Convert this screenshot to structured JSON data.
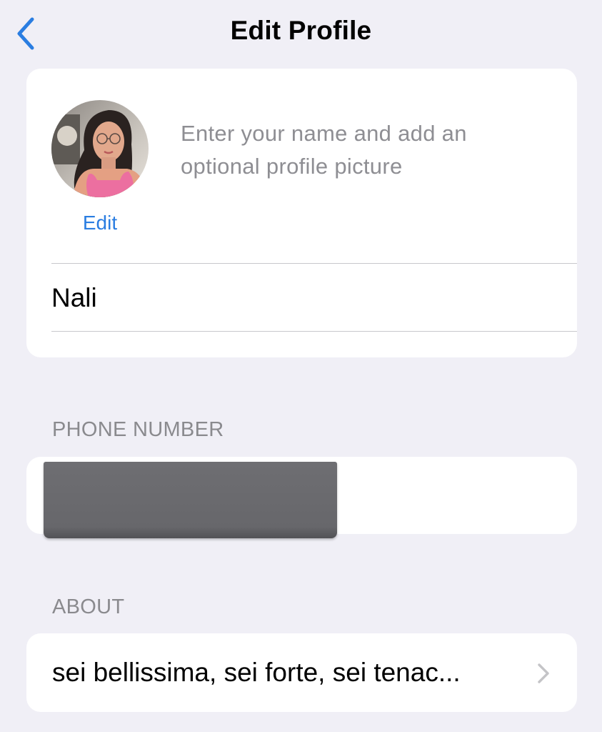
{
  "nav": {
    "title": "Edit Profile",
    "back_icon": "chevron-left-icon",
    "accent_color": "#2a7de1"
  },
  "profile": {
    "hint": "Enter your name and add an optional profile picture",
    "avatar_edit_label": "Edit",
    "name_value": "Nali",
    "name_placeholder": ""
  },
  "phone": {
    "header": "PHONE NUMBER"
  },
  "about": {
    "header": "ABOUT",
    "text": "sei bellissima, sei forte, sei tenac...",
    "chevron_icon": "chevron-right-icon"
  }
}
